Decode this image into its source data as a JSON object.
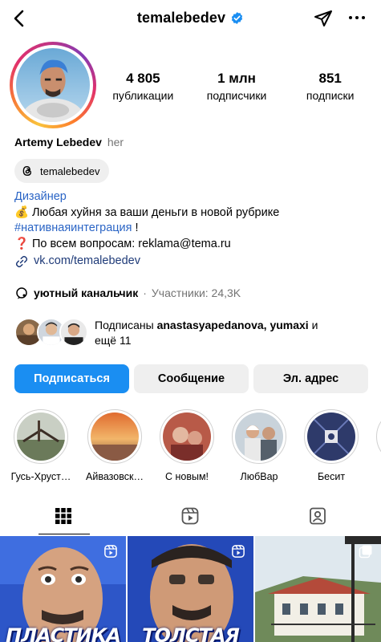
{
  "header": {
    "username": "temalebedev"
  },
  "profile": {
    "stats": [
      {
        "value": "4 805",
        "label": "публикации"
      },
      {
        "value": "1 млн",
        "label": "подписчики"
      },
      {
        "value": "851",
        "label": "подписки"
      }
    ],
    "name": "Artemy Lebedev",
    "pronouns": "her",
    "threads_handle": "temalebedev"
  },
  "bio": {
    "category": "Дизайнер",
    "line1_emoji": "💰",
    "line1": "Любая хуйня за ваши деньги в новой рубрике",
    "hashtag": "#нативнаяинтеграция",
    "hashtag_suffix": " !",
    "line3_emoji": "❓",
    "line3": "По всем вопросам: reklama@tema.ru",
    "link": "vk.com/temalebedev"
  },
  "channel": {
    "name": "уютный канальчик",
    "separator": "·",
    "members": "Участники: 24,3K"
  },
  "followed_by": {
    "prefix": "Подписаны ",
    "names": "anastasyapedanova, yumaxi",
    "suffix": " и",
    "more": "ещё 11"
  },
  "buttons": {
    "follow": "Подписаться",
    "message": "Сообщение",
    "email": "Эл. адрес"
  },
  "highlights": [
    {
      "label": "Гусь-Хруст…"
    },
    {
      "label": "Айвазовск…"
    },
    {
      "label": "С новым!"
    },
    {
      "label": "ЛюбВар"
    },
    {
      "label": "Бесит"
    }
  ],
  "tabs": [
    {
      "name": "grid-icon",
      "active": true
    },
    {
      "name": "reels-icon",
      "active": false
    },
    {
      "name": "tagged-icon",
      "active": false
    }
  ],
  "posts": [
    {
      "caption": "ПЛАСТИКА",
      "type": "reel"
    },
    {
      "caption": "ТОЛСТАЯ",
      "type": "reel"
    },
    {
      "caption": "",
      "type": "photo"
    }
  ],
  "colors": {
    "accent_blue": "#1a8ef2",
    "link_blue": "#2a64c5",
    "secondary_button": "#efefef",
    "muted_text": "#737373"
  }
}
